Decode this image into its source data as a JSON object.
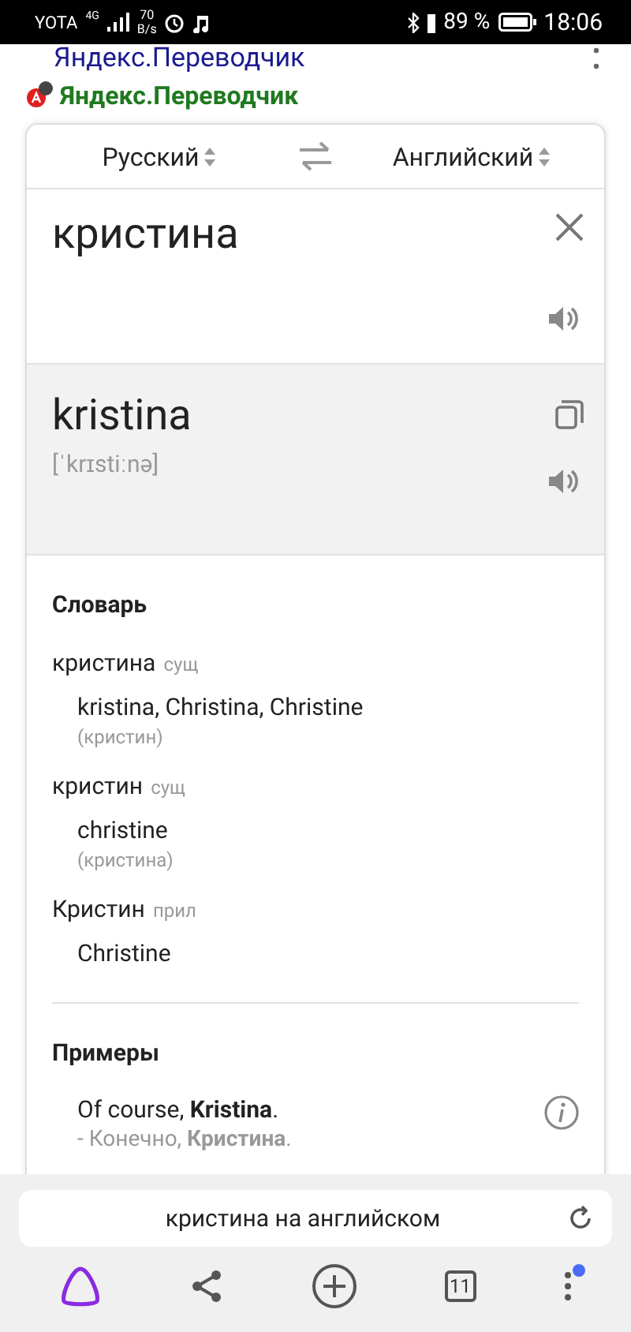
{
  "status_bar": {
    "carrier": "YOTA",
    "network": "4G",
    "speed": "70",
    "speed_unit": "B/s",
    "battery": "89 %",
    "time": "18:06"
  },
  "page_title": "Яндекс.Переводчик",
  "site_name": "Яндекс.Переводчик",
  "translator": {
    "source_lang": "Русский",
    "target_lang": "Английский",
    "input": "кристина",
    "output": "kristina",
    "transcription": "[ˈkrɪstiːnə]"
  },
  "dictionary": {
    "title": "Словарь",
    "entries": [
      {
        "word": "кристина",
        "pos": "сущ",
        "translations": "kristina, Christina, Christine",
        "note": "(кристин)"
      },
      {
        "word": "кристин",
        "pos": "сущ",
        "translations": "christine",
        "note": "(кристина)"
      },
      {
        "word": "Кристин",
        "pos": "прил",
        "translations": "Christine"
      }
    ]
  },
  "examples": {
    "title": "Примеры",
    "items": [
      {
        "text": "Of course, **Kristina**.",
        "translation": "- Конечно, **Кристина**."
      }
    ]
  },
  "browser": {
    "query": "кристина на английском",
    "tabs_count": "11",
    "menu_notification": true
  }
}
